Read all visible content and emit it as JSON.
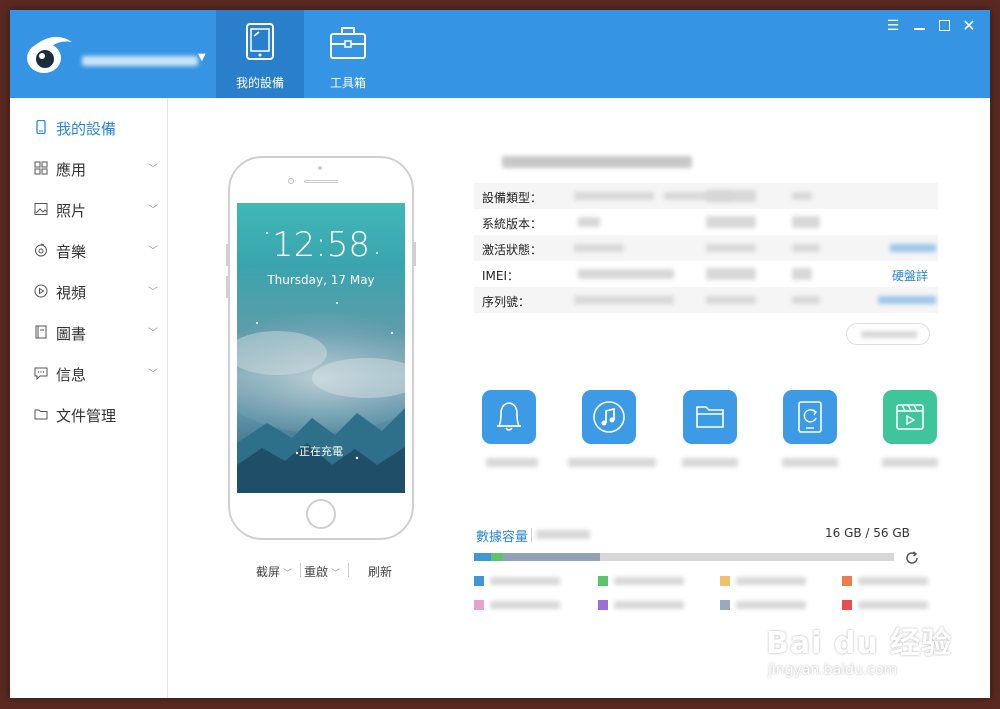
{
  "app": {
    "account_name": "",
    "tabs": [
      {
        "label": "我的設備",
        "icon": "tablet-icon"
      },
      {
        "label": "工具箱",
        "icon": "toolbox-icon"
      }
    ],
    "window_controls": [
      "menu-icon",
      "minimize-icon",
      "maximize-icon",
      "close-icon"
    ]
  },
  "sidebar": {
    "items": [
      {
        "label": "我的設備",
        "icon": "phone-icon",
        "selected": true,
        "expandable": false
      },
      {
        "label": "應用",
        "icon": "apps-grid-icon",
        "selected": false,
        "expandable": true
      },
      {
        "label": "照片",
        "icon": "photo-icon",
        "selected": false,
        "expandable": true
      },
      {
        "label": "音樂",
        "icon": "music-icon",
        "selected": false,
        "expandable": true
      },
      {
        "label": "視頻",
        "icon": "video-play-icon",
        "selected": false,
        "expandable": true
      },
      {
        "label": "圖書",
        "icon": "book-icon",
        "selected": false,
        "expandable": true
      },
      {
        "label": "信息",
        "icon": "message-icon",
        "selected": false,
        "expandable": true
      },
      {
        "label": "文件管理",
        "icon": "folder-icon",
        "selected": false,
        "expandable": false
      }
    ]
  },
  "phone": {
    "time": "12:58",
    "date": "Thursday, 17 May",
    "status": "正在充電",
    "actions": [
      {
        "label": "截屏",
        "dropdown": true
      },
      {
        "label": "重啟",
        "dropdown": true
      },
      {
        "label": "刷新",
        "dropdown": false
      }
    ]
  },
  "device_info": {
    "rows": [
      {
        "key": "設備類型：",
        "link": ""
      },
      {
        "key": "系統版本：",
        "link": ""
      },
      {
        "key": "激活狀態：",
        "link": ""
      },
      {
        "key": "IMEI：",
        "link": "硬盤詳情"
      },
      {
        "key": "序列號：",
        "link": ""
      }
    ]
  },
  "quick_tools": [
    {
      "icon": "bell-icon",
      "color": "#3d9ae5"
    },
    {
      "icon": "music-note-icon",
      "color": "#3d9ae5"
    },
    {
      "icon": "folder-icon",
      "color": "#3d9ae5"
    },
    {
      "icon": "tablet-sync-icon",
      "color": "#3d9ae5"
    },
    {
      "icon": "video-clip-icon",
      "color": "#3ec69a"
    }
  ],
  "storage": {
    "tab_label": "數據容量",
    "usage_text": "16 GB / 56 GB",
    "refresh_icon": "refresh-icon",
    "segments": [
      {
        "color": "#3f97d8",
        "fraction": 0.04
      },
      {
        "color": "#5cc568",
        "fraction": 0.03
      },
      {
        "color": "#8ea4b6",
        "fraction": 0.23
      }
    ],
    "legend_colors": [
      "#3f97d8",
      "#5cc568",
      "#f0c070",
      "#f07a4e",
      "#e8a0d0",
      "#9b6fd8",
      "#9aa9bf",
      "#e84e4e"
    ]
  },
  "colors": {
    "accent": "#3594e3",
    "accent_dark": "#2a7fcb",
    "selected_text": "#2b86d8"
  },
  "watermark": {
    "brand": "Bai du 经验",
    "url": "jingyan.baidu.com"
  }
}
